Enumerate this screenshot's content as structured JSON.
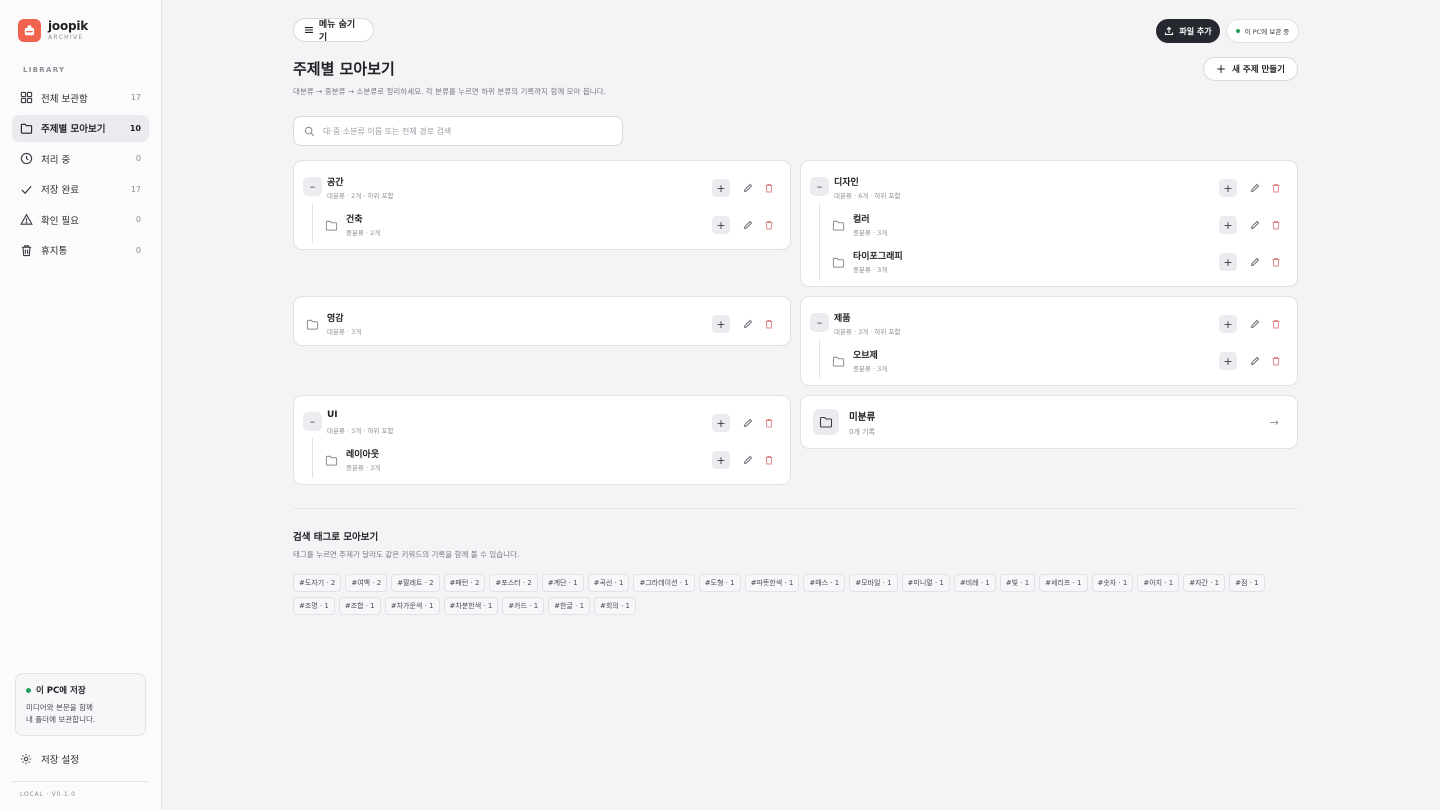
{
  "brand": {
    "name": "joopik",
    "sub": "ARCHIVE"
  },
  "sidebar": {
    "section_label": "LIBRARY",
    "items": [
      {
        "label": "전체 보관함",
        "count": "17",
        "icon": "grid-icon"
      },
      {
        "label": "주제별 모아보기",
        "count": "10",
        "icon": "folder-icon"
      },
      {
        "label": "처리 중",
        "count": "0",
        "icon": "clock-icon"
      },
      {
        "label": "저장 완료",
        "count": "17",
        "icon": "check-icon"
      },
      {
        "label": "확인 필요",
        "count": "0",
        "icon": "warning-icon"
      },
      {
        "label": "휴지통",
        "count": "0",
        "icon": "trash-icon"
      }
    ],
    "save_card": {
      "title": "이 PC에 저장",
      "line1": "미디어와 본문을 함께",
      "line2": "내 폴더에 보관합니다."
    },
    "settings_label": "저장 설정",
    "version": "LOCAL · V0.1.0"
  },
  "topbar": {
    "menu_label": "메뉴 숨기기",
    "add_file_label": "파일 추가",
    "storage_status": "이 PC에 보관 중"
  },
  "page": {
    "title": "주제별 모아보기",
    "description": "대분류 → 중분류 → 소분류로 정리하세요. 각 분류를 누르면 하위 분류의 기록까지 함께 모아 봅니다.",
    "new_topic_label": "새 주제 만들기",
    "search_placeholder": "대·중·소분류 이름 또는 전체 경로 검색"
  },
  "topics": {
    "space": {
      "name": "공간",
      "meta": "대분류 · 2개 · 하위 포함",
      "children": [
        {
          "name": "건축",
          "meta": "중분류 · 2개"
        }
      ]
    },
    "design": {
      "name": "디자인",
      "meta": "대분류 · 6개 · 하위 포함",
      "children": [
        {
          "name": "컬러",
          "meta": "중분류 · 3개"
        },
        {
          "name": "타이포그래피",
          "meta": "중분류 · 3개"
        }
      ]
    },
    "inspiration": {
      "name": "영감",
      "meta": "대분류 · 3개"
    },
    "product": {
      "name": "제품",
      "meta": "대분류 · 3개 · 하위 포함",
      "children": [
        {
          "name": "오브제",
          "meta": "중분류 · 3개"
        }
      ]
    },
    "ui": {
      "name": "UI",
      "meta": "대분류 · 3개 · 하위 포함",
      "children": [
        {
          "name": "레이아웃",
          "meta": "중분류 · 3개"
        }
      ]
    },
    "uncategorized": {
      "name": "미분류",
      "meta": "0개 기록"
    }
  },
  "tags_section": {
    "title": "검색 태그로 모아보기",
    "description": "태그를 누르면 주제가 달라도 같은 키워드의 기록을 함께 볼 수 있습니다.",
    "tags": [
      "#도자기 · 2",
      "#여백 · 2",
      "#팔레트 · 2",
      "#패턴 · 2",
      "#포스터 · 2",
      "#계단 · 1",
      "#곡선 · 1",
      "#그라데이션 · 1",
      "#도형 · 1",
      "#따뜻한색 · 1",
      "#매스 · 1",
      "#모바일 · 1",
      "#미니멀 · 1",
      "#비례 · 1",
      "#빛 · 1",
      "#세리프 · 1",
      "#숫자 · 1",
      "#아치 · 1",
      "#자간 · 1",
      "#점 · 1",
      "#조명 · 1",
      "#조합 · 1",
      "#차가운색 · 1",
      "#차분한색 · 1",
      "#카드 · 1",
      "#한글 · 1",
      "#회의 · 1"
    ]
  },
  "colors": {
    "accent": "#f0634f",
    "dark_button": "#262830",
    "success": "#22a05a"
  }
}
